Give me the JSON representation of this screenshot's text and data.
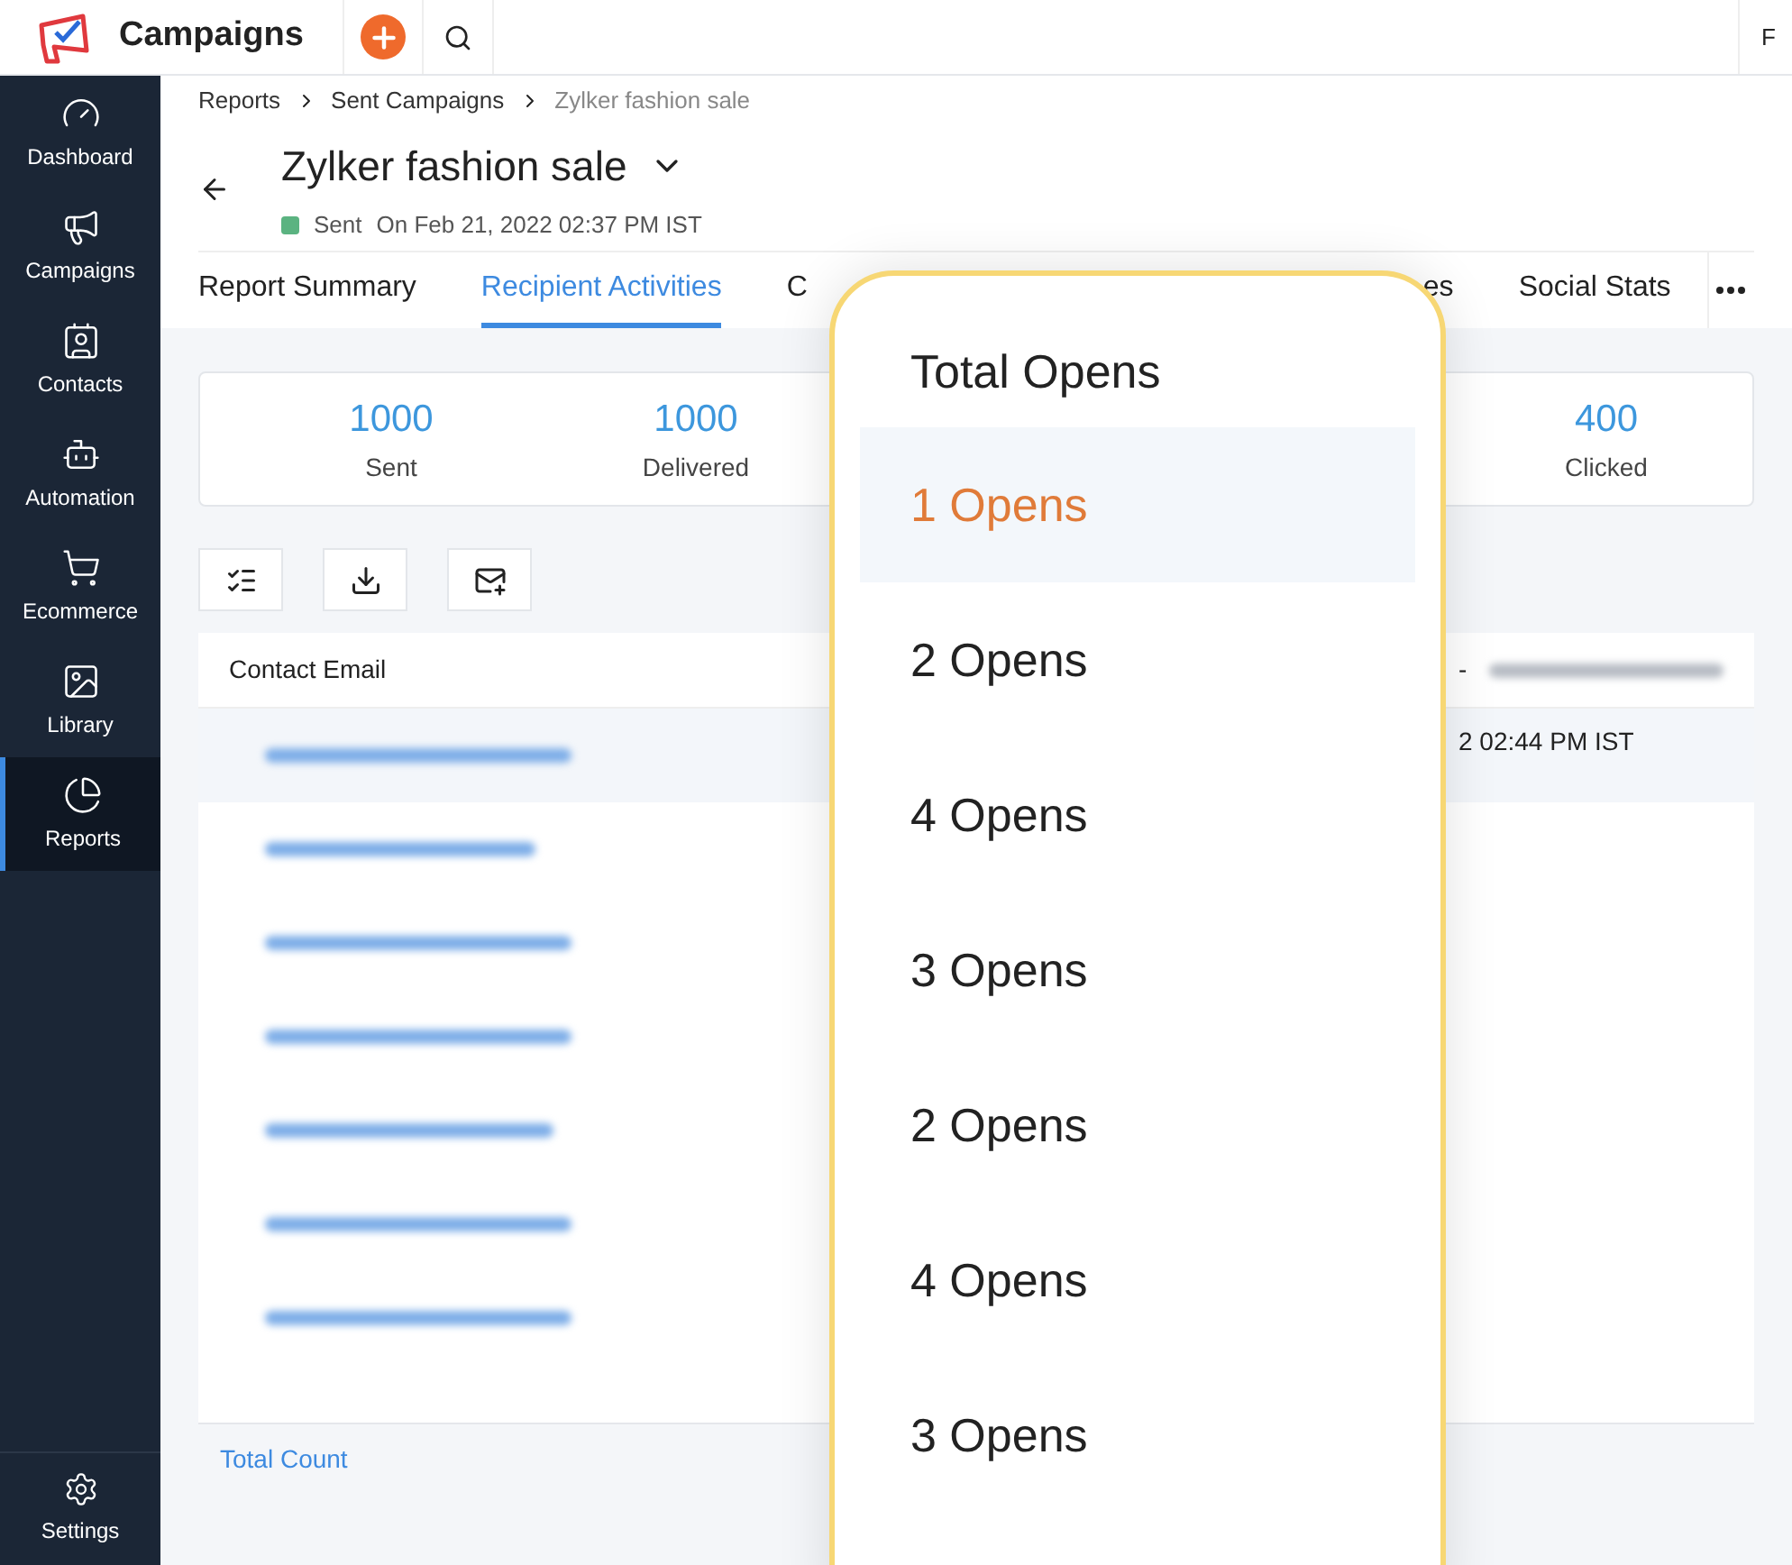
{
  "app": {
    "name": "Campaigns"
  },
  "top_bar": {
    "edge_text": "F"
  },
  "sidebar": {
    "items": [
      {
        "kind": "dashboard",
        "label": "Dashboard",
        "selected": false
      },
      {
        "kind": "campaigns",
        "label": "Campaigns",
        "selected": false
      },
      {
        "kind": "contacts",
        "label": "Contacts",
        "selected": false
      },
      {
        "kind": "automation",
        "label": "Automation",
        "selected": false
      },
      {
        "kind": "ecommerce",
        "label": "Ecommerce",
        "selected": false
      },
      {
        "kind": "library",
        "label": "Library",
        "selected": false
      },
      {
        "kind": "reports",
        "label": "Reports",
        "selected": true
      }
    ],
    "footer": {
      "label": "Settings"
    }
  },
  "breadcrumb": [
    "Reports",
    "Sent Campaigns",
    "Zylker fashion sale"
  ],
  "campaign": {
    "title": "Zylker fashion sale",
    "status": "Sent",
    "date": "On Feb 21, 2022 02:37 PM IST"
  },
  "tabs": [
    {
      "label": "Report Summary",
      "selected": false
    },
    {
      "label": "Recipient Activities",
      "selected": true
    },
    {
      "label": "C",
      "selected": false
    },
    {
      "label": "es",
      "selected": false
    },
    {
      "label": "Social Stats",
      "selected": false
    }
  ],
  "stats": [
    {
      "value": "1000",
      "label": "Sent"
    },
    {
      "value": "1000",
      "label": "Delivered"
    },
    {
      "value": "400",
      "label": "Clicked"
    }
  ],
  "table": {
    "columns": [
      "Contact Email"
    ],
    "column_2_header": "-",
    "rows": [
      {
        "selected": true,
        "column_2": "2 02:44 PM IST"
      },
      {
        "selected": false
      },
      {
        "selected": false
      },
      {
        "selected": false
      },
      {
        "selected": false
      },
      {
        "selected": false
      },
      {
        "selected": false
      }
    ],
    "footer": "Total Count"
  },
  "popup": {
    "title": "Total Opens",
    "items": [
      {
        "label": "1 Opens",
        "selected": true
      },
      {
        "label": "2 Opens",
        "selected": false
      },
      {
        "label": "4 Opens",
        "selected": false
      },
      {
        "label": "3 Opens",
        "selected": false
      },
      {
        "label": "2 Opens",
        "selected": false
      },
      {
        "label": "4 Opens",
        "selected": false
      },
      {
        "label": "3 Opens",
        "selected": false
      }
    ]
  }
}
